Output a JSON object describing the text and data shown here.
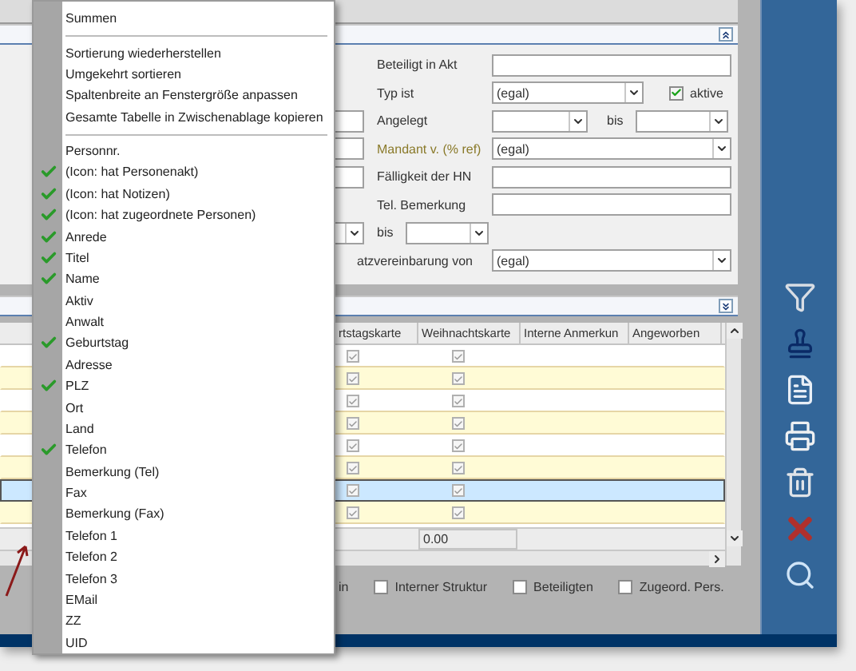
{
  "context_menu": {
    "items": [
      {
        "kind": "command",
        "label": "Summen"
      },
      {
        "kind": "separator"
      },
      {
        "kind": "command",
        "label": "Sortierung wiederherstellen"
      },
      {
        "kind": "command",
        "label": "Umgekehrt sortieren"
      },
      {
        "kind": "command",
        "label": "Spaltenbreite an Fenstergröße anpassen"
      },
      {
        "kind": "command",
        "label": "Gesamte Tabelle in Zwischenablage kopieren"
      },
      {
        "kind": "separator"
      },
      {
        "kind": "column",
        "label": "Personnr.",
        "checked": false
      },
      {
        "kind": "column",
        "label": "(Icon: hat Personenakt)",
        "checked": true
      },
      {
        "kind": "column",
        "label": "(Icon: hat Notizen)",
        "checked": true
      },
      {
        "kind": "column",
        "label": "(Icon: hat zugeordnete Personen)",
        "checked": true
      },
      {
        "kind": "column",
        "label": "Anrede",
        "checked": true
      },
      {
        "kind": "column",
        "label": "Titel",
        "checked": true
      },
      {
        "kind": "column",
        "label": "Name",
        "checked": true
      },
      {
        "kind": "column",
        "label": "Aktiv",
        "checked": false
      },
      {
        "kind": "column",
        "label": "Anwalt",
        "checked": false
      },
      {
        "kind": "column",
        "label": "Geburtstag",
        "checked": true
      },
      {
        "kind": "column",
        "label": "Adresse",
        "checked": false
      },
      {
        "kind": "column",
        "label": "PLZ",
        "checked": true
      },
      {
        "kind": "column",
        "label": "Ort",
        "checked": false
      },
      {
        "kind": "column",
        "label": "Land",
        "checked": false
      },
      {
        "kind": "column",
        "label": "Telefon",
        "checked": true
      },
      {
        "kind": "column",
        "label": "Bemerkung (Tel)",
        "checked": false
      },
      {
        "kind": "column",
        "label": "Fax",
        "checked": false
      },
      {
        "kind": "column",
        "label": "Bemerkung (Fax)",
        "checked": false
      },
      {
        "kind": "column",
        "label": "Telefon 1",
        "checked": false
      },
      {
        "kind": "column",
        "label": "Telefon 2",
        "checked": false
      },
      {
        "kind": "column",
        "label": "Telefon 3",
        "checked": false
      },
      {
        "kind": "column",
        "label": "EMail",
        "checked": false
      },
      {
        "kind": "column",
        "label": "ZZ",
        "checked": false
      },
      {
        "kind": "column",
        "label": "UID",
        "checked": false
      }
    ]
  },
  "filter": {
    "beteiligt": {
      "label": "Beteiligt in Akt"
    },
    "typ": {
      "label": "Typ ist",
      "value": "(egal)",
      "aktive": {
        "label": "aktive",
        "checked": true
      }
    },
    "angelegt": {
      "label": "Angelegt",
      "bis": "bis"
    },
    "mandant": {
      "label": "Mandant v. (% ref)",
      "value": "(egal)"
    },
    "faelligkeit": {
      "label": "Fälligkeit der HN"
    },
    "tel_bemerkung": {
      "label": "Tel. Bemerkung"
    },
    "range_bis": "bis",
    "vereinbarung": {
      "label": "atzvereinbarung von",
      "value": "(egal)"
    }
  },
  "table": {
    "columns": [
      "rtstagskarte",
      "Weihnachtskarte",
      "Interne Anmerkun",
      "Angeworben"
    ],
    "rows": [
      {
        "selected": false,
        "birthday_card": true,
        "christmas_card": true
      },
      {
        "selected": false,
        "birthday_card": true,
        "christmas_card": true
      },
      {
        "selected": false,
        "birthday_card": true,
        "christmas_card": true
      },
      {
        "selected": false,
        "birthday_card": true,
        "christmas_card": true
      },
      {
        "selected": false,
        "birthday_card": true,
        "christmas_card": true
      },
      {
        "selected": false,
        "birthday_card": true,
        "christmas_card": true
      },
      {
        "selected": true,
        "birthday_card": true,
        "christmas_card": true
      },
      {
        "selected": false,
        "birthday_card": true,
        "christmas_card": true
      }
    ],
    "footer": "0.00"
  },
  "options": [
    {
      "kind": "text",
      "label": "in"
    },
    {
      "kind": "checkbox",
      "label": "Interner Struktur",
      "checked": false
    },
    {
      "kind": "checkbox",
      "label": "Beteiligten",
      "checked": false
    },
    {
      "kind": "checkbox",
      "label": "Zugeord. Pers.",
      "checked": false
    }
  ]
}
